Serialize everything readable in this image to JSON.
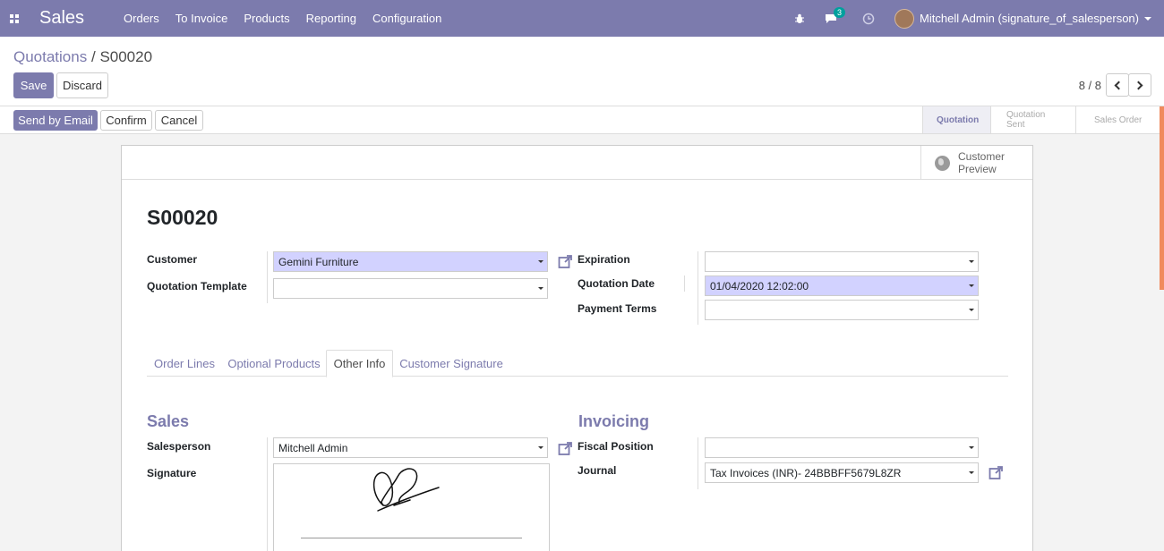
{
  "navbar": {
    "app_name": "Sales",
    "menu": [
      "Orders",
      "To Invoice",
      "Products",
      "Reporting",
      "Configuration"
    ],
    "chat_badge": "3",
    "user_name": "Mitchell Admin (signature_of_salesperson)"
  },
  "breadcrumb": {
    "parent": "Quotations",
    "separator": "/",
    "current": "S00020"
  },
  "toolbar": {
    "save_label": "Save",
    "discard_label": "Discard",
    "pager": "8 / 8"
  },
  "actions": {
    "send_email": "Send by Email",
    "confirm": "Confirm",
    "cancel": "Cancel"
  },
  "status_steps": {
    "items": [
      "Quotation",
      "Quotation Sent",
      "Sales Order"
    ],
    "active": "Quotation"
  },
  "sheet": {
    "preview_line1": "Customer",
    "preview_line2": "Preview",
    "title": "S00020",
    "fields": {
      "customer_label": "Customer",
      "customer_value": "Gemini Furniture",
      "template_label": "Quotation Template",
      "template_value": "",
      "expiration_label": "Expiration",
      "expiration_value": "",
      "quotation_date_label": "Quotation Date",
      "quotation_date_value": "01/04/2020 12:02:00",
      "payment_terms_label": "Payment Terms",
      "payment_terms_value": ""
    },
    "tabs": [
      "Order Lines",
      "Optional Products",
      "Other Info",
      "Customer Signature"
    ],
    "active_tab": "Other Info",
    "sales_group": {
      "title": "Sales",
      "salesperson_label": "Salesperson",
      "salesperson_value": "Mitchell Admin",
      "signature_label": "Signature"
    },
    "invoicing_group": {
      "title": "Invoicing",
      "fiscal_position_label": "Fiscal Position",
      "fiscal_position_value": "",
      "journal_label": "Journal",
      "journal_value": "Tax Invoices (INR)- 24BBBFF5679L8ZR"
    }
  },
  "colors": {
    "brand": "#7c7bad",
    "required_field": "#d2d2ff",
    "badge": "#00a09d"
  }
}
